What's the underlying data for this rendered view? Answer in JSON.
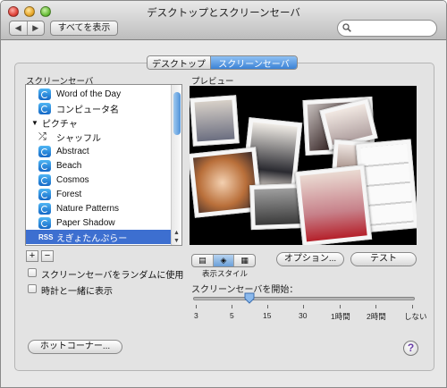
{
  "window": {
    "title": "デスクトップとスクリーンセーバ",
    "show_all_label": "すべてを表示",
    "back_label": "◀",
    "forward_label": "▶"
  },
  "tabs": [
    {
      "label": "デスクトップ",
      "selected": false
    },
    {
      "label": "スクリーンセーバ",
      "selected": true
    }
  ],
  "list": {
    "heading": "スクリーンセーバ",
    "items": [
      {
        "label": "Word of the Day",
        "icon": "screensaver-icon"
      },
      {
        "label": "コンピュータ名",
        "icon": "screensaver-icon"
      },
      {
        "label": "ピクチャ",
        "icon": "disclosure-triangle-icon",
        "group": true
      },
      {
        "label": "シャッフル",
        "icon": "shuffle-icon"
      },
      {
        "label": "Abstract",
        "icon": "screensaver-icon"
      },
      {
        "label": "Beach",
        "icon": "screensaver-icon"
      },
      {
        "label": "Cosmos",
        "icon": "screensaver-icon"
      },
      {
        "label": "Forest",
        "icon": "screensaver-icon"
      },
      {
        "label": "Nature Patterns",
        "icon": "screensaver-icon"
      },
      {
        "label": "Paper Shadow",
        "icon": "screensaver-icon"
      },
      {
        "label": "えぎょたんぷらー",
        "icon": "rss-icon",
        "rss_text": "RSS",
        "selected": true
      }
    ],
    "add_label": "+",
    "remove_label": "−"
  },
  "options": {
    "random_label": "スクリーンセーバをランダムに使用",
    "clock_label": "時計と一緒に表示"
  },
  "preview": {
    "heading": "プレビュー",
    "display_style_label": "表示スタイル",
    "options_button": "オプション...",
    "test_button": "テスト"
  },
  "start": {
    "label": "スクリーンセーバを開始：",
    "ticks": [
      "3",
      "5",
      "15",
      "30",
      "1時間",
      "2時間",
      "しない"
    ],
    "selected": "15"
  },
  "hot_corners_button": "ホットコーナー...",
  "help_label": "?",
  "colors": {
    "selection": "#3d6fd0",
    "tab_selected": "#3b82d6",
    "help_accent": "#6a3fa8"
  }
}
